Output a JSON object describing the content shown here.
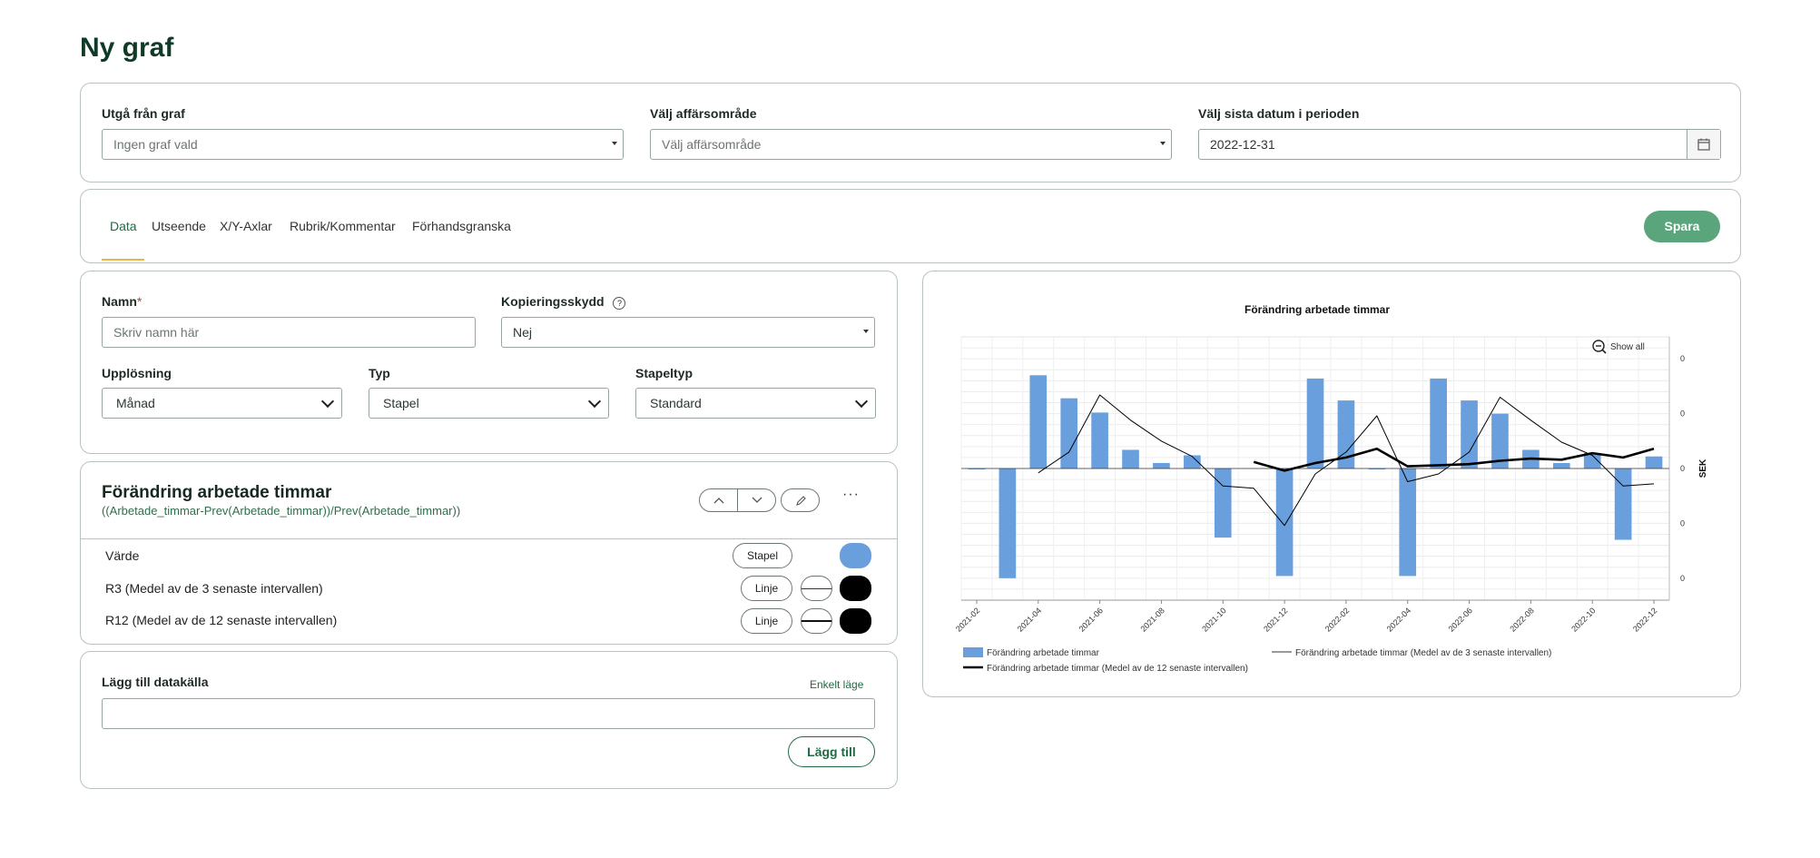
{
  "page": {
    "title": "Ny graf"
  },
  "top_filters": {
    "graph_label": "Utgå från graf",
    "graph_value": "Ingen graf vald",
    "area_label": "Välj affärsområde",
    "area_value": "Välj affärsområde",
    "date_label": "Välj sista datum i perioden",
    "date_value": "2022-12-31"
  },
  "tabs": [
    {
      "label": "Data"
    },
    {
      "label": "Utseende"
    },
    {
      "label": "X/Y-Axlar"
    },
    {
      "label": "Rubrik/Kommentar"
    },
    {
      "label": "Förhandsgranska"
    }
  ],
  "save_label": "Spara",
  "form": {
    "name_label": "Namn",
    "name_required": "*",
    "name_placeholder": "Skriv namn här",
    "copy_label": "Kopieringsskydd",
    "copy_value": "Nej",
    "res_label": "Upplösning",
    "res_value": "Månad",
    "type_label": "Typ",
    "type_value": "Stapel",
    "bartype_label": "Stapeltyp",
    "bartype_value": "Standard"
  },
  "series_card": {
    "title": "Förändring arbetade timmar",
    "formula": "((Arbetade_timmar-Prev(Arbetade_timmar))/Prev(Arbetade_timmar))",
    "rows": [
      {
        "label": "Värde",
        "type": "Stapel",
        "color": "#6a9fdd"
      },
      {
        "label": "R3 (Medel av de 3 senaste intervallen)",
        "type": "Linje",
        "color": "#000000"
      },
      {
        "label": "R12 (Medel av de 12 senaste intervallen)",
        "type": "Linje",
        "color": "#000000"
      }
    ]
  },
  "datasource": {
    "title": "Lägg till datakälla",
    "mode_link": "Enkelt läge",
    "add_label": "Lägg till"
  },
  "colors": {
    "accent": "#5aa57b",
    "bar": "#6a9fdd",
    "tab_underline": "#e8b74a"
  },
  "chart_data": {
    "type": "bar",
    "title": "Förändring arbetade timmar",
    "ylabel": "SEK",
    "xlabel": "",
    "zoom_label": "Show all",
    "y_ticks": [
      "0",
      "0",
      "0",
      "0",
      "0"
    ],
    "x_ticks": [
      "2021-02",
      "2021-04",
      "2021-06",
      "2021-08",
      "2021-10",
      "2021-12",
      "2022-02",
      "2022-04",
      "2022-06",
      "2022-08",
      "2022-10",
      "2022-12"
    ],
    "categories": [
      "2021-02",
      "2021-03",
      "2021-04",
      "2021-05",
      "2021-06",
      "2021-07",
      "2021-08",
      "2021-09",
      "2021-10",
      "2021-11",
      "2021-12",
      "2022-01",
      "2022-02",
      "2022-03",
      "2022-04",
      "2022-05",
      "2022-06",
      "2022-07",
      "2022-08",
      "2022-09",
      "2022-10",
      "2022-11",
      "2022-12"
    ],
    "ylim": [
      -1.2,
      1.2
    ],
    "grid": true,
    "legend_position": "bottom",
    "series": [
      {
        "name": "Förändring arbetade timmar",
        "kind": "bar",
        "values": [
          0,
          -1.0,
          0.85,
          0.64,
          0.51,
          0.17,
          0.05,
          0.12,
          -0.63,
          null,
          -0.98,
          0.82,
          0.62,
          0,
          -0.98,
          0.82,
          0.62,
          0.5,
          0.17,
          0.05,
          0.14,
          -0.65,
          0.11
        ]
      },
      {
        "name": "Förändring arbetade timmar (Medel av de 3 senaste intervallen)",
        "kind": "line",
        "values": [
          null,
          null,
          -0.04,
          0.15,
          0.67,
          0.44,
          0.25,
          0.11,
          -0.16,
          -0.18,
          -0.52,
          -0.05,
          0.15,
          0.48,
          -0.12,
          -0.05,
          0.15,
          0.65,
          0.44,
          0.24,
          0.12,
          -0.16,
          -0.14
        ]
      },
      {
        "name": "Förändring arbetade timmar (Medel av de 12 senaste intervallen)",
        "kind": "line",
        "values": [
          null,
          null,
          null,
          null,
          null,
          null,
          null,
          null,
          null,
          0.06,
          -0.02,
          0.05,
          0.1,
          0.18,
          0.02,
          0.03,
          0.04,
          0.07,
          0.09,
          0.08,
          0.14,
          0.1,
          0.18
        ]
      }
    ]
  }
}
